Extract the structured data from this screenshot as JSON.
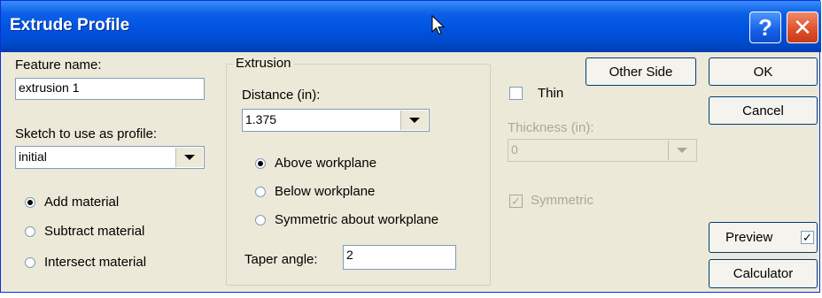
{
  "window": {
    "title": "Extrude Profile",
    "help_label": "?",
    "close_label": "✕"
  },
  "feature_name": {
    "label": "Feature name:",
    "value": "extrusion 1"
  },
  "sketch": {
    "label": "Sketch to use as profile:",
    "value": "initial"
  },
  "material": {
    "options": [
      "Add material",
      "Subtract material",
      "Intersect material"
    ],
    "selected": 0
  },
  "extrusion": {
    "title": "Extrusion",
    "distance_label": "Distance (in):",
    "distance_value": "1.375",
    "directions": [
      "Above workplane",
      "Below workplane",
      "Symmetric about workplane"
    ],
    "selected": 0,
    "taper_label": "Taper angle:",
    "taper_value": "2"
  },
  "other_side": {
    "label": "Other Side"
  },
  "thin": {
    "label": "Thin",
    "checked": false
  },
  "thickness": {
    "label": "Thickness (in):",
    "value": "0"
  },
  "symmetric": {
    "label": "Symmetric",
    "checked": true
  },
  "buttons": {
    "ok": "OK",
    "cancel": "Cancel",
    "preview": "Preview",
    "calculator": "Calculator"
  },
  "preview_check": {
    "checked": true,
    "mark": "✓"
  },
  "icons": {
    "cursor": "arrow-cursor-icon",
    "help": "help-icon",
    "close": "close-icon",
    "dropdown": "chevron-down-icon"
  },
  "colors": {
    "titlebar": "#0053e0",
    "dialog_bg": "#ece9d8",
    "close": "#e0522c"
  }
}
